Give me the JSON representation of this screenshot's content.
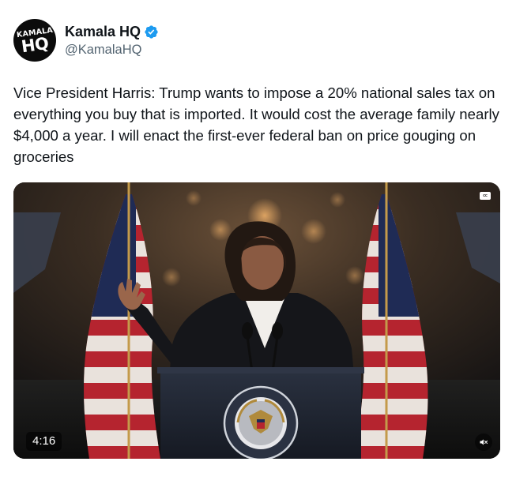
{
  "author": {
    "avatar_text_top": "KAMALA",
    "avatar_text_big": "HQ",
    "display_name": "Kamala HQ",
    "handle": "@KamalaHQ",
    "verified": true,
    "verified_color": "#1d9bf0"
  },
  "tweet": {
    "text": "Vice President Harris: Trump wants to impose a 20% national sales tax on everything you buy that is imported. It would cost the average family nearly $4,000 a year. I will enact the first-ever federal ban on price gouging on groceries"
  },
  "video": {
    "duration": "4:16",
    "cc_label": "cc",
    "mute_icon": "speaker-muted-icon",
    "seal_text": "SEAL OF THE VICE PRESIDENT OF THE UNITED STATES"
  }
}
